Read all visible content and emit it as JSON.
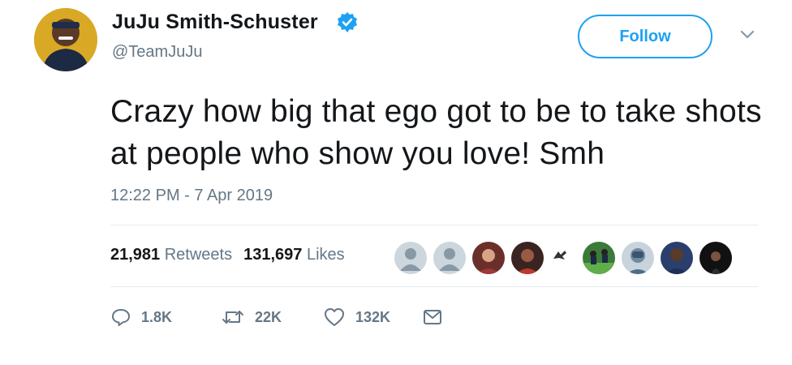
{
  "author": {
    "display_name": "JuJu Smith-Schuster",
    "handle": "@TeamJuJu",
    "avatar_icon": "profile-photo",
    "verified_icon": "verified-badge-icon"
  },
  "follow_button": {
    "label": "Follow"
  },
  "tweet": {
    "text": "Crazy how big that ego got to be to take shots at people who show you love! Smh",
    "timestamp": "12:22 PM - 7 Apr 2019"
  },
  "stats": {
    "retweets_count": "21,981",
    "retweets_label": "Retweets",
    "likes_count": "131,697",
    "likes_label": "Likes"
  },
  "actions": {
    "reply_count": "1.8K",
    "retweet_count": "22K",
    "like_count": "132K"
  },
  "colors": {
    "brand_blue": "#1da1f2",
    "secondary_text": "#657786",
    "divider": "#e6ecf0"
  }
}
